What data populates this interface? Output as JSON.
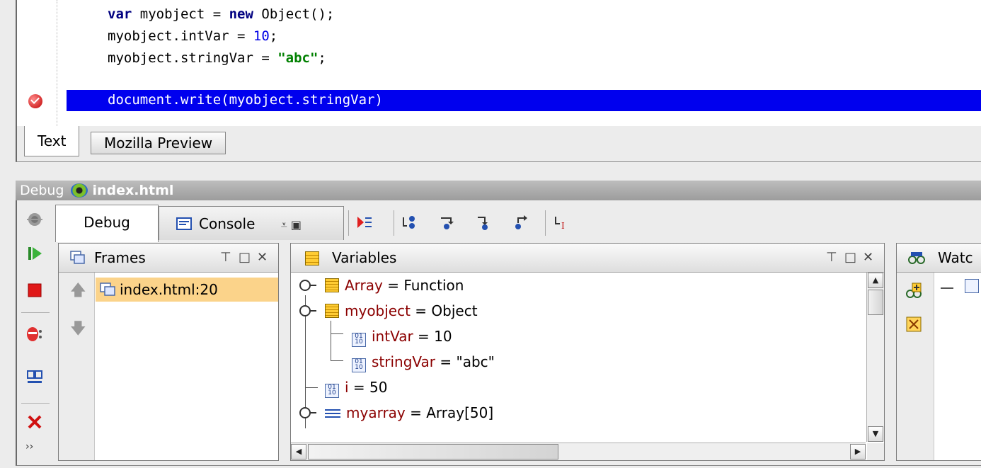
{
  "editor": {
    "lines": [
      {
        "kw": "var",
        "rest": " myobject = ",
        "kw2": "new",
        "rest2": " Object();"
      },
      {
        "text": "myobject.intVar = ",
        "num": "10",
        "end": ";"
      },
      {
        "text": "myobject.stringVar = ",
        "str": "\"abc\"",
        "end": ";"
      }
    ],
    "current_line": "document.write(myobject.stringVar)",
    "tabs": {
      "text": "Text",
      "mozilla_preview": "Mozilla Preview"
    }
  },
  "debug_window": {
    "label": "Debug",
    "file": "index.html"
  },
  "debug_tabs": {
    "debug": "Debug",
    "console": "Console"
  },
  "frames_panel": {
    "title": "Frames",
    "controls": [
      "⊤",
      "□",
      "✕"
    ],
    "items": [
      {
        "label": "index.html:20",
        "selected": true
      }
    ]
  },
  "variables_panel": {
    "title": "Variables",
    "controls": [
      "⊤",
      "□",
      "✕"
    ],
    "rows": [
      {
        "name": "Array",
        "value": " = Function"
      },
      {
        "name": "myobject",
        "value": " = Object"
      },
      {
        "name": "intVar",
        "value": " = 10"
      },
      {
        "name": "stringVar",
        "value": " = \"abc\""
      },
      {
        "name": "i",
        "value": " = 50"
      },
      {
        "name": "myarray",
        "value": " = Array[50]"
      }
    ]
  },
  "watches_panel": {
    "title": "Watc"
  },
  "colors": {
    "highlight": "#0000ee",
    "selected_frame": "#fbd38a",
    "var_name": "#8b0000"
  }
}
